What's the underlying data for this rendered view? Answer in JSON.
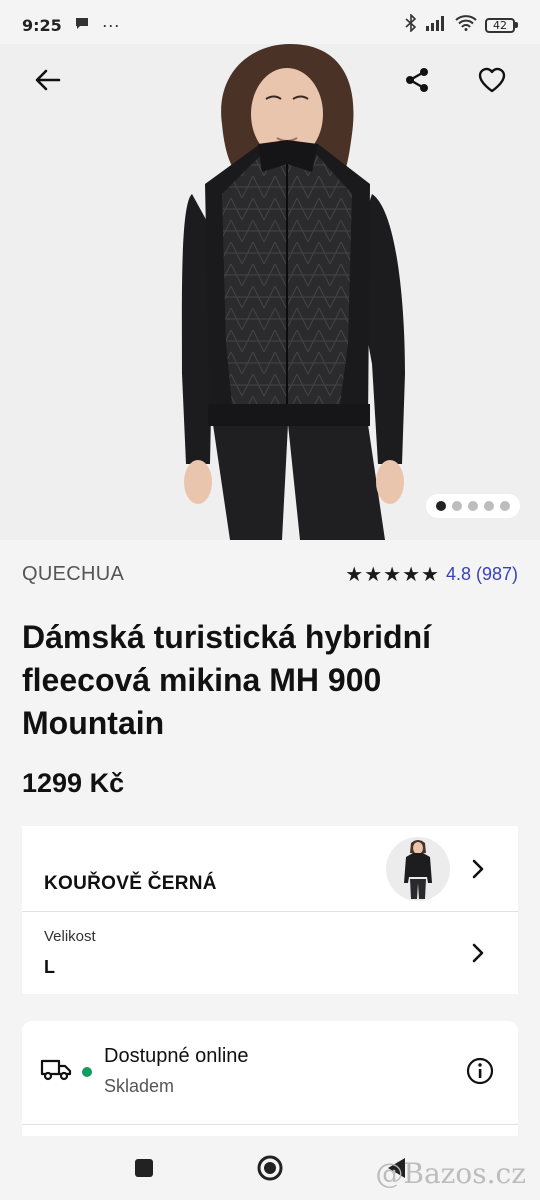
{
  "status_bar": {
    "time": "9:25",
    "battery": "42"
  },
  "gallery": {
    "image_alt": "Žena v černé prošívané hybridní mikině",
    "slides_total": 5,
    "slide_active": 1
  },
  "product": {
    "brand": "QUECHUA",
    "stars": "★★★★★",
    "rating": "4.8 (987)",
    "title": "Dámská turistická hybridní fleecová mikina MH 900 Mountain",
    "price": "1299 Kč"
  },
  "variant": {
    "color": "KOUŘOVĚ ČERNÁ",
    "size_label": "Velikost",
    "size_value": "L"
  },
  "availability": {
    "title": "Dostupné online",
    "subtitle": "Skladem"
  },
  "watermark": "@Bazos.cz",
  "colors": {
    "accent": "#3643ba",
    "stock_green": "#149b5f"
  }
}
